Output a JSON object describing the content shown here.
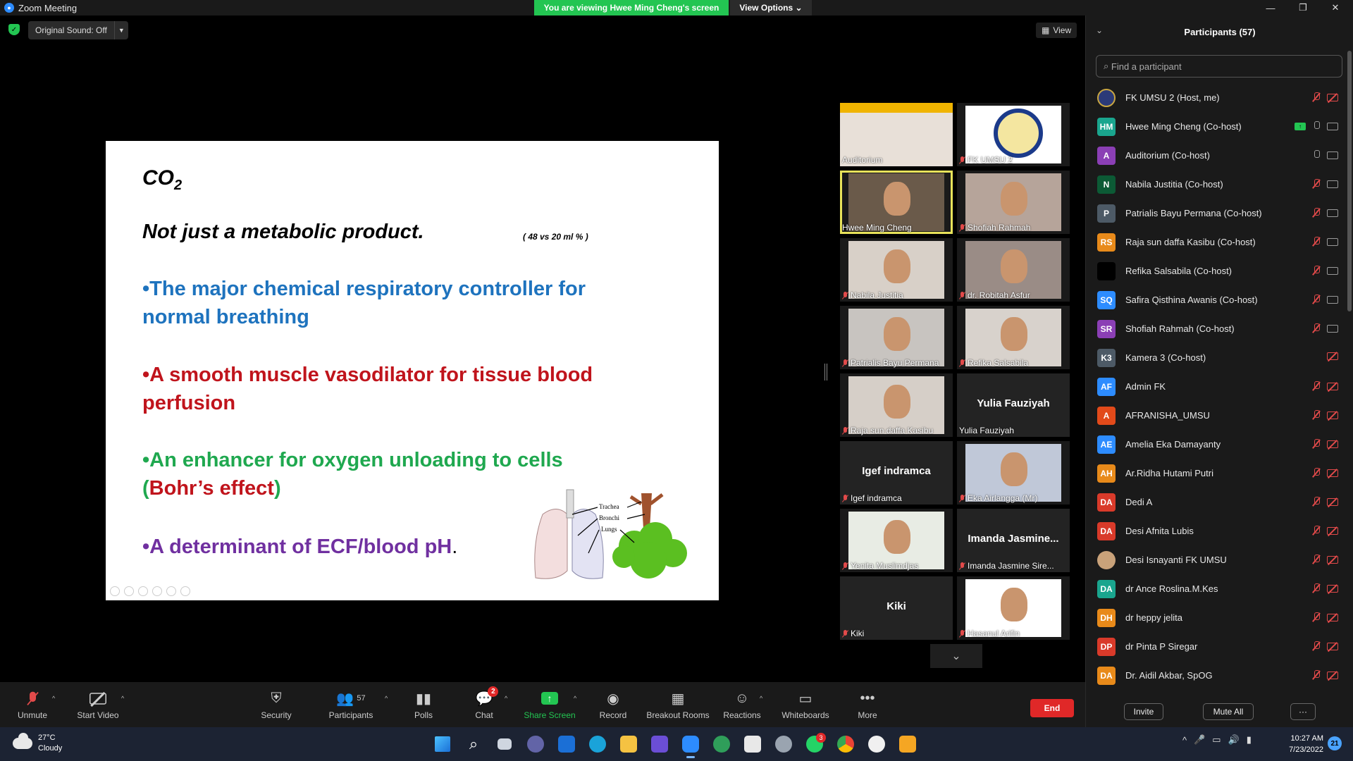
{
  "window": {
    "title": "Zoom Meeting",
    "viewing_banner": "You are viewing Hwee Ming Cheng's screen",
    "view_options": "View Options",
    "minimize": "—",
    "restore": "❐",
    "close": "✕"
  },
  "meeting_bar": {
    "original_sound": "Original Sound: Off",
    "view_label": "View"
  },
  "slide": {
    "title_main": "CO",
    "title_sub": "2",
    "subtitle": "Not just a metabolic product.",
    "note": "( 48  vs 20 ml % )",
    "bullet1": "•The major chemical respiratory controller for normal breathing",
    "bullet2": "•A smooth muscle vasodilator for tissue blood perfusion",
    "bullet3_main": "•An enhancer for oxygen unloading to cells ",
    "bullet3_paren_open": "(",
    "bullet3_red": "Bohr’s effect",
    "bullet3_paren_close": ")",
    "bullet4_main": "•A determinant of ECF/blood pH",
    "bullet4_dot": ".",
    "label_trachea": "Trachea",
    "label_bronchi": "Bronchi",
    "label_lungs": "Lungs"
  },
  "tiles": [
    {
      "name": "Auditorium"
    },
    {
      "name": "FK UMSU 2"
    },
    {
      "name": "Hwee Ming Cheng"
    },
    {
      "name": "Shofiah Rahmah"
    },
    {
      "name": "Nabila Justitia"
    },
    {
      "name": "dr. Robitah Asfur"
    },
    {
      "name": "Patrialis Bayu Permana"
    },
    {
      "name": "Refika Salsabila"
    },
    {
      "name": "Raja sun daffa Kasibu"
    },
    {
      "name": "Yulia Fauziyah",
      "big": "Yulia Fauziyah"
    },
    {
      "name": "Igef indramca",
      "big": "Igef indramca"
    },
    {
      "name": "Eka Airlangga (Mr)"
    },
    {
      "name": "Yenita Muslimdjas"
    },
    {
      "name": "Imanda Jasmine Sire...",
      "big": "Imanda  Jasmine..."
    },
    {
      "name": "Kiki",
      "big": "Kiki"
    },
    {
      "name": "Hasanul Arifin"
    }
  ],
  "participants": {
    "title": "Participants (57)",
    "search_placeholder": "Find a participant",
    "list": [
      {
        "initials": "",
        "name": "FK UMSU 2 (Host, me)",
        "color": "#2b3a78"
      },
      {
        "initials": "HM",
        "name": "Hwee Ming Cheng (Co-host)",
        "color": "#1aa58e"
      },
      {
        "initials": "A",
        "name": "Auditorium (Co-host)",
        "color": "#8b3fb5"
      },
      {
        "initials": "N",
        "name": "Nabila Justitia (Co-host)",
        "color": "#0c5a35"
      },
      {
        "initials": "P",
        "name": "Patrialis Bayu Permana (Co-host)",
        "color": "#4d5a66"
      },
      {
        "initials": "RS",
        "name": "Raja sun daffa Kasibu (Co-host)",
        "color": "#e88a1a"
      },
      {
        "initials": "",
        "name": "Refika Salsabila (Co-host)",
        "color": "#000000"
      },
      {
        "initials": "SQ",
        "name": "Safira Qisthina Awanis (Co-host)",
        "color": "#2d8cff"
      },
      {
        "initials": "SR",
        "name": "Shofiah Rahmah (Co-host)",
        "color": "#8b3fb5"
      },
      {
        "initials": "K3",
        "name": "Kamera 3 (Co-host)",
        "color": "#4d5a66"
      },
      {
        "initials": "AF",
        "name": "Admin FK",
        "color": "#2d8cff"
      },
      {
        "initials": "A",
        "name": "AFRANISHA_UMSU",
        "color": "#e24a1a"
      },
      {
        "initials": "AE",
        "name": "Amelia Eka Damayanty",
        "color": "#2d8cff"
      },
      {
        "initials": "AH",
        "name": "Ar.Ridha Hutami Putri",
        "color": "#e88a1a"
      },
      {
        "initials": "DA",
        "name": "Dedi A",
        "color": "#d93a2a"
      },
      {
        "initials": "DA",
        "name": "Desi Afnita Lubis",
        "color": "#d93a2a"
      },
      {
        "initials": "",
        "name": "Desi Isnayanti FK UMSU",
        "color": "#c9a27a"
      },
      {
        "initials": "DA",
        "name": "dr Ance Roslina.M.Kes",
        "color": "#1aa58e"
      },
      {
        "initials": "DH",
        "name": "dr heppy jelita",
        "color": "#e88a1a"
      },
      {
        "initials": "DP",
        "name": "dr Pinta P Siregar",
        "color": "#d93a2a"
      },
      {
        "initials": "DA",
        "name": "Dr. Aidil Akbar, SpOG",
        "color": "#e88a1a"
      }
    ],
    "invite": "Invite",
    "mute_all": "Mute All",
    "more": "···"
  },
  "toolbar": {
    "unmute": "Unmute",
    "start_video": "Start Video",
    "security": "Security",
    "participants": "Participants",
    "participants_count": "57",
    "polls": "Polls",
    "chat": "Chat",
    "chat_badge": "2",
    "share_screen": "Share Screen",
    "record": "Record",
    "breakout": "Breakout Rooms",
    "reactions": "Reactions",
    "whiteboards": "Whiteboards",
    "more": "More",
    "end": "End"
  },
  "taskbar": {
    "temp": "27°C",
    "weather": "Cloudy",
    "time": "10:27 AM",
    "date": "7/23/2022",
    "notif_count": "21",
    "whatsapp_badge": "3"
  }
}
